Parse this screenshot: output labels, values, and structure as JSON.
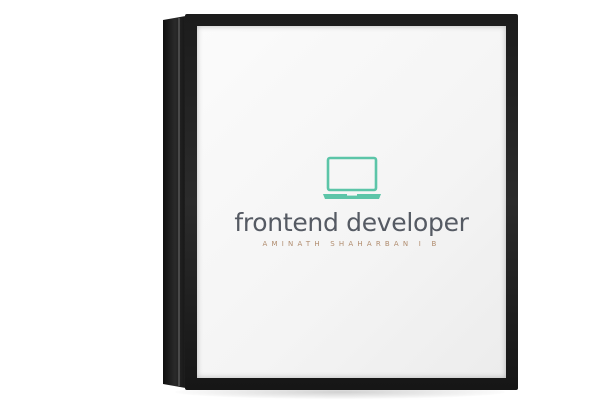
{
  "sign": {
    "title": "frontend developer",
    "subtitle": "AMINATH SHAHARBAN I B",
    "icon": "laptop-icon",
    "colors": {
      "icon": "#5cc5a8",
      "title": "#555a63",
      "subtitle": "#b08c6e",
      "frame": "#1c1c1c",
      "panel": "#f6f6f6"
    }
  }
}
